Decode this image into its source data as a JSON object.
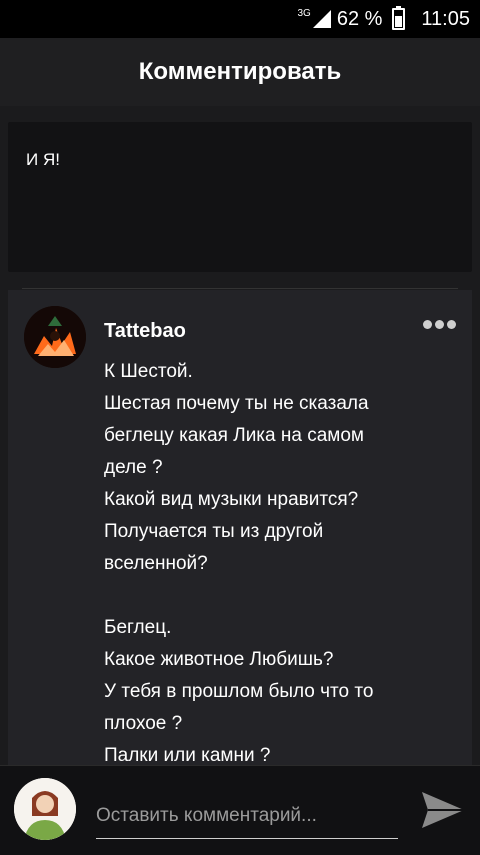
{
  "status_bar": {
    "network": "3G",
    "battery_percent": "62 %",
    "battery_level": 0.62,
    "time": "11:05"
  },
  "app_bar": {
    "title": "Комментировать"
  },
  "reply": {
    "text": "И Я!"
  },
  "comment": {
    "author": "Tattebao",
    "lines": [
      "К Шестой.",
      "Шестая почему ты не сказала",
      "беглецу какая Лика на самом",
      "деле ?",
      "Какой вид музыки нравится?",
      "Получается ты из другой",
      "вселенной?",
      "",
      "Беглец.",
      "Какое животное Любишь?",
      "У тебя в прошлом было что то",
      "плохое ?",
      "Палки или камни ?"
    ]
  },
  "bottom_bar": {
    "placeholder": "Оставить комментарий..."
  },
  "colors": {
    "background": "#1b1b1d",
    "card": "#232327",
    "reply_box": "#121214",
    "accent": "#ff6a1a"
  },
  "icons": {
    "more": "more-dots-icon",
    "send": "send-icon"
  }
}
